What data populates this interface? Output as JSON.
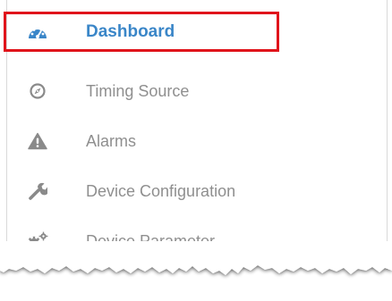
{
  "menu": {
    "items": [
      {
        "label": "Dashboard",
        "icon": "dashboard-gauge-icon",
        "active": true
      },
      {
        "label": "Timing Source",
        "icon": "compass-icon",
        "active": false
      },
      {
        "label": "Alarms",
        "icon": "warning-icon",
        "active": false
      },
      {
        "label": "Device Configuration",
        "icon": "wrench-icon",
        "active": false
      },
      {
        "label": "Device Parameter",
        "icon": "gears-icon",
        "active": false
      }
    ]
  },
  "colors": {
    "active_text": "#3a86c8",
    "inactive_text": "#8f8f8f",
    "icon_inactive": "#8a8a8a",
    "highlight_box": "#e0141b"
  }
}
